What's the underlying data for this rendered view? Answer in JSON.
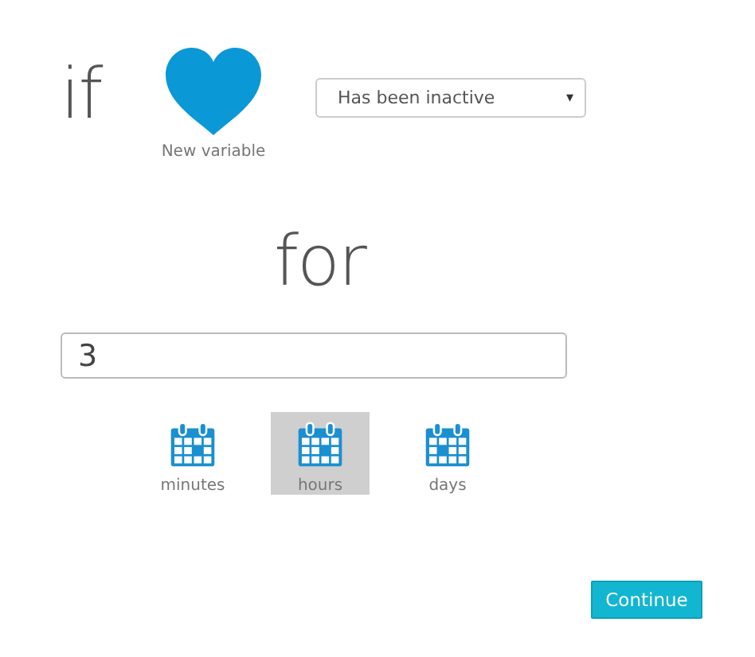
{
  "condition": {
    "keyword": "if",
    "variable_label": "New variable",
    "select_value": "Has been inactive",
    "select_arrow": "▾"
  },
  "duration": {
    "keyword": "for",
    "value": "3"
  },
  "units": [
    {
      "label": "minutes",
      "selected": false
    },
    {
      "label": "hours",
      "selected": true
    },
    {
      "label": "days",
      "selected": false
    }
  ],
  "buttons": [
    {
      "label": "Continue"
    }
  ]
}
